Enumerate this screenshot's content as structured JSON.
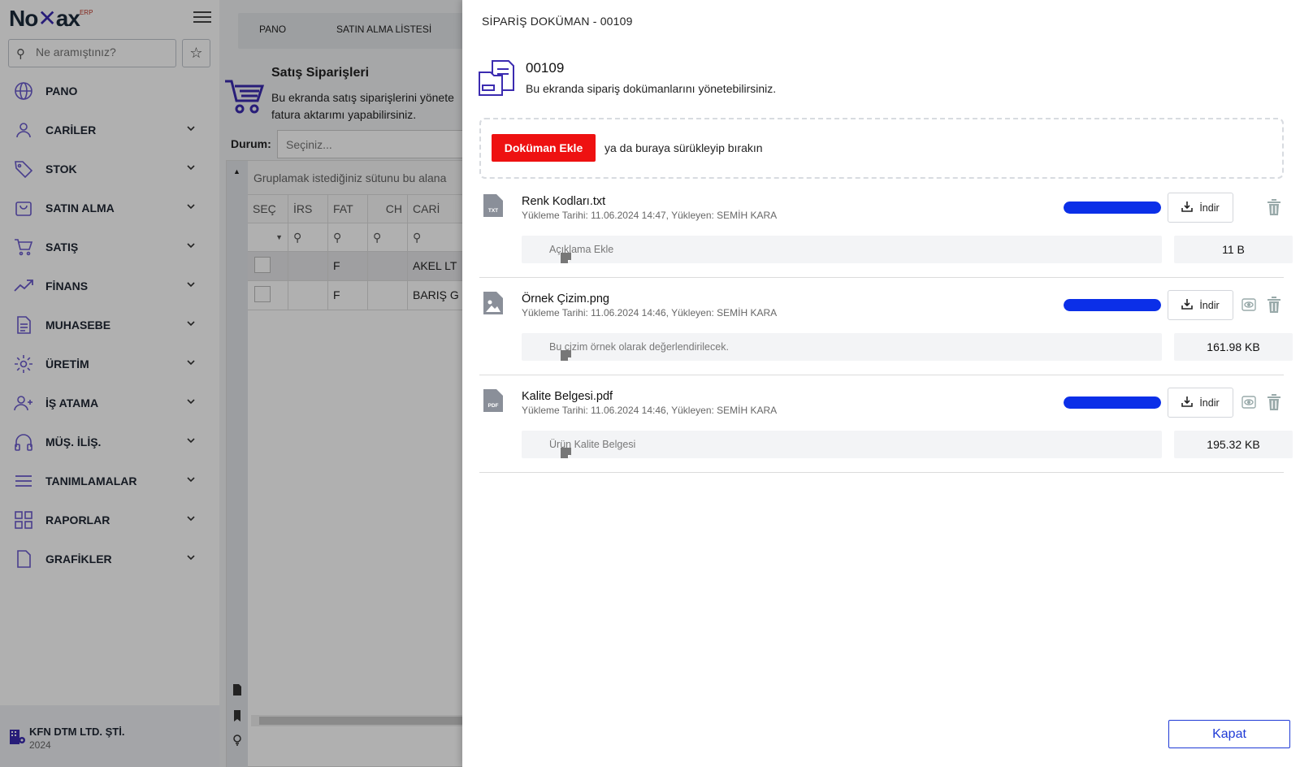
{
  "brand": {
    "logo_text_a": "No",
    "logo_text_b": "ax",
    "logo_sup": "ERP"
  },
  "search": {
    "placeholder": "Ne aramıştınız?"
  },
  "sidebar": {
    "items": [
      {
        "label": "PANO",
        "icon": "globe-icon",
        "expandable": false
      },
      {
        "label": "CARİLER",
        "icon": "user-icon",
        "expandable": true
      },
      {
        "label": "STOK",
        "icon": "tag-icon",
        "expandable": true
      },
      {
        "label": "SATIN ALMA",
        "icon": "shopping-bag-icon",
        "expandable": true
      },
      {
        "label": "SATIŞ",
        "icon": "cart-icon",
        "expandable": true
      },
      {
        "label": "FİNANS",
        "icon": "trending-up-icon",
        "expandable": true
      },
      {
        "label": "MUHASEBE",
        "icon": "document-icon",
        "expandable": true
      },
      {
        "label": "ÜRETİM",
        "icon": "gear-icon",
        "expandable": true
      },
      {
        "label": "İŞ ATAMA",
        "icon": "user-plus-icon",
        "expandable": true
      },
      {
        "label": "MÜŞ. İLİŞ.",
        "icon": "headphones-icon",
        "expandable": true
      },
      {
        "label": "TANIMLAMALAR",
        "icon": "menu-lines-icon",
        "expandable": true
      },
      {
        "label": "RAPORLAR",
        "icon": "grid-icon",
        "expandable": true
      },
      {
        "label": "GRAFİKLER",
        "icon": "file-icon",
        "expandable": true
      }
    ]
  },
  "company": {
    "name": "KFN DTM LTD. ŞTİ.",
    "year": "2024"
  },
  "tabs": [
    {
      "label": "PANO"
    },
    {
      "label": "SATIN ALMA LİSTESİ"
    }
  ],
  "page": {
    "title": "Satış Siparişleri",
    "description": "Bu ekranda satış siparişlerini yönete fatura aktarımı yapabilirsiniz.",
    "durum_label": "Durum:",
    "durum_placeholder": "Seçiniz...",
    "group_hint": "Gruplamak istediğiniz sütunu bu alana",
    "columns": [
      "SEÇ",
      "İRS",
      "FAT",
      "CH",
      "CARİ"
    ],
    "rows": [
      {
        "fat": "F",
        "cari": "AKEL LT"
      },
      {
        "fat": "F",
        "cari": "BARIŞ G"
      }
    ]
  },
  "modal": {
    "title": "SİPARİŞ DOKÜMAN - 00109",
    "doc_no": "00109",
    "description": "Bu ekranda sipariş dokümanlarını yönetebilirsiniz.",
    "add_button": "Doküman Ekle",
    "drop_text": "ya da buraya sürükleyip bırakın",
    "download_label": "İndir",
    "close_button": "Kapat",
    "files": [
      {
        "name": "Renk Kodları.txt",
        "meta": "Yükleme Tarihi: 11.06.2024 14:47, Yükleyen: SEMİH KARA",
        "type": "TXT",
        "note": "Açıklama Ekle",
        "size": "11 B",
        "progress": 1.0,
        "previewable": false
      },
      {
        "name": "Örnek Çizim.png",
        "meta": "Yükleme Tarihi: 11.06.2024 14:46, Yükleyen: SEMİH KARA",
        "type": "image",
        "note": "Bu çizim örnek olarak değerlendirilecek.",
        "size": "161.98 KB",
        "progress": 1.0,
        "previewable": true
      },
      {
        "name": "Kalite Belgesi.pdf",
        "meta": "Yükleme Tarihi: 11.06.2024 14:46, Yükleyen: SEMİH KARA",
        "type": "PDF",
        "note": "Ürün Kalite Belgesi",
        "size": "195.32 KB",
        "progress": 1.0,
        "previewable": true
      }
    ]
  },
  "colors": {
    "accent": "#3b2bb0",
    "danger": "#ee1111",
    "progress": "#0b2fe8",
    "primary": "#1f3ad6"
  }
}
